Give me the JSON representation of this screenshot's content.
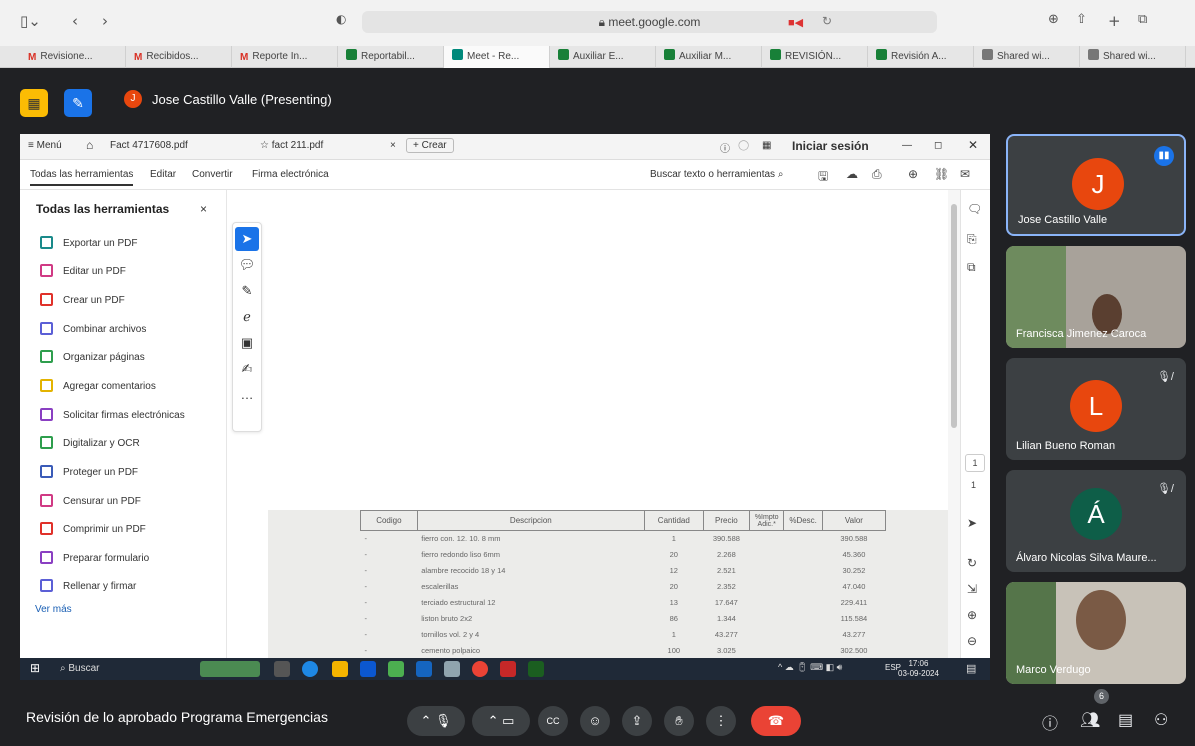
{
  "browser": {
    "url": "meet.google.com",
    "tabs": [
      "Revisione...",
      "Recibidos...",
      "Reporte In...",
      "Reportabil...",
      "Meet - Re...",
      "Auxiliar E...",
      "Auxiliar M...",
      "REVISIÓN...",
      "Revisión A...",
      "Shared wi...",
      "Shared wi..."
    ]
  },
  "meet": {
    "presenter_initial": "J",
    "presenter_label": "Jose Castillo Valle (Presenting)",
    "meeting_title": "Revisión de lo aprobado Programa Emergencias",
    "people_count": "6",
    "participants": [
      {
        "name": "Jose Castillo Valle",
        "initial": "J",
        "color": "#e8470e"
      },
      {
        "name": "Francisca Jimenez Caroca",
        "initial": ""
      },
      {
        "name": "Lilian Bueno Roman",
        "initial": "L",
        "color": "#e8470e"
      },
      {
        "name": "Álvaro Nicolas Silva Maure...",
        "initial": "Á",
        "color": "#0e5e48"
      },
      {
        "name": "Marco Verdugo",
        "initial": ""
      }
    ]
  },
  "acrobat": {
    "menu": "Menú",
    "tab_file1": "Fact 4717608.pdf",
    "tab_file2": "fact 211.pdf",
    "new_tab": "+ Crear",
    "login": "Iniciar sesión",
    "tool_tabs": [
      "Todas las herramientas",
      "Editar",
      "Convertir",
      "Firma electrónica"
    ],
    "search_placeholder": "Buscar texto o herramientas",
    "panel_title": "Todas las herramientas",
    "tools": [
      "Exportar un PDF",
      "Editar un PDF",
      "Crear un PDF",
      "Combinar archivos",
      "Organizar páginas",
      "Agregar comentarios",
      "Solicitar firmas electrónicas",
      "Digitalizar y OCR",
      "Proteger un PDF",
      "Censurar un PDF",
      "Comprimir un PDF",
      "Preparar formulario",
      "Rellenar y firmar"
    ],
    "see_more": "Ver más",
    "page_number": "1",
    "page_total": "1"
  },
  "invoice": {
    "headers": [
      "Codigo",
      "Descripcion",
      "Cantidad",
      "Precio",
      "%Impto Adic.*",
      "%Desc.",
      "Valor"
    ],
    "rows": [
      [
        "-",
        "fierro con. 12. 10. 8 mm",
        "1",
        "390.588",
        "",
        "",
        "390.588"
      ],
      [
        "-",
        "fierro redondo liso 6mm",
        "20",
        "2.268",
        "",
        "",
        "45.360"
      ],
      [
        "-",
        "alambre recocido 18 y 14",
        "12",
        "2.521",
        "",
        "",
        "30.252"
      ],
      [
        "-",
        "escalerillas",
        "20",
        "2.352",
        "",
        "",
        "47.040"
      ],
      [
        "-",
        "terciado estructural 12",
        "13",
        "17.647",
        "",
        "",
        "229.411"
      ],
      [
        "-",
        "liston bruto 2x2",
        "86",
        "1.344",
        "",
        "",
        "115.584"
      ],
      [
        "-",
        "tornillos vol. 2 y 4",
        "1",
        "43.277",
        "",
        "",
        "43.277"
      ],
      [
        "-",
        "cemento polpaico",
        "100",
        "3.025",
        "",
        "",
        "302.500"
      ]
    ]
  },
  "taskbar": {
    "search": "Buscar",
    "lang": "ESP",
    "time": "17:06",
    "date": "03-09-2024"
  }
}
